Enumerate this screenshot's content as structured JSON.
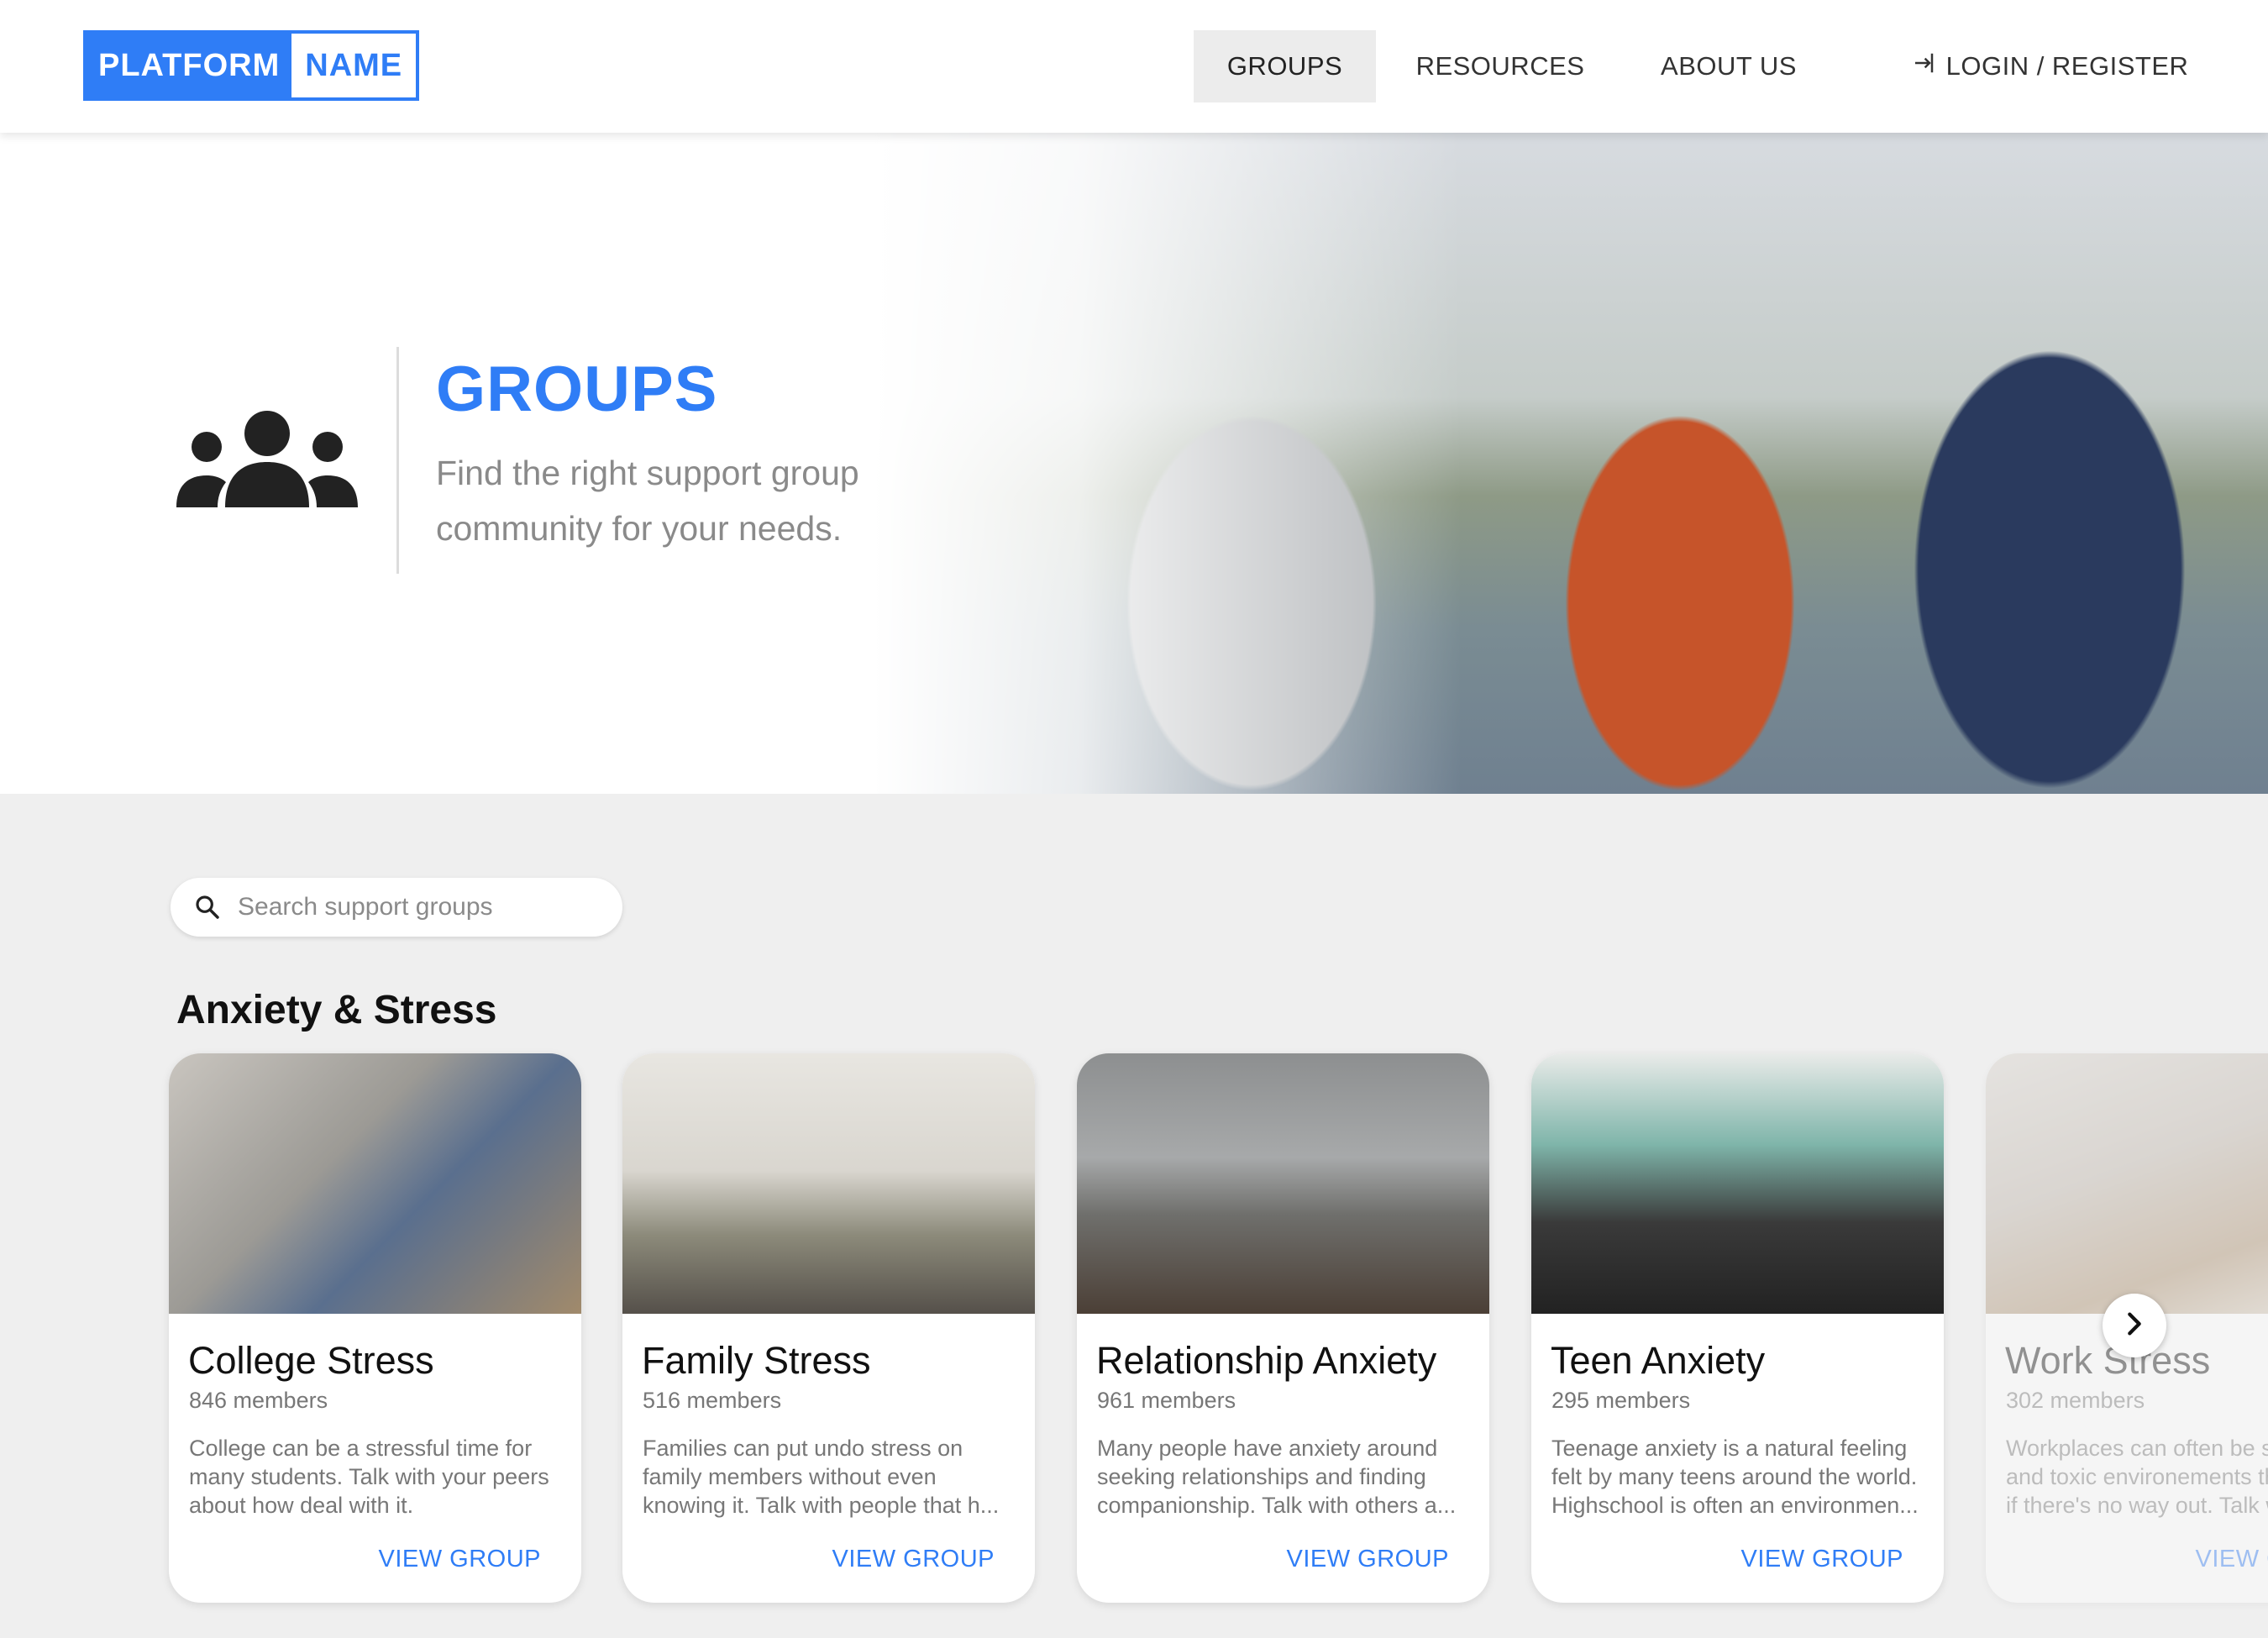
{
  "header": {
    "logo_part1": "PLATFORM",
    "logo_part2": "NAME",
    "nav": {
      "groups": "GROUPS",
      "resources": "RESOURCES",
      "about": "ABOUT US",
      "login": "LOGIN / REGISTER"
    },
    "active_nav": "GROUPS"
  },
  "hero": {
    "title": "GROUPS",
    "subtitle": "Find the right support group community for your needs.",
    "icon": "people-group-icon"
  },
  "search": {
    "placeholder": "Search support groups",
    "value": ""
  },
  "section": {
    "title": "Anxiety & Stress"
  },
  "cards": [
    {
      "name": "College Stress",
      "members": "846 members",
      "description": "College can be a stressful time for many students. Talk with your peers about how deal with it.",
      "action": "VIEW GROUP"
    },
    {
      "name": "Family Stress",
      "members": "516 members",
      "description": "Families can put undo stress on family members without even knowing it. Talk with people that h...",
      "action": "VIEW GROUP"
    },
    {
      "name": "Relationship Anxiety",
      "members": "961 members",
      "description": "Many people have anxiety around seeking relationships and finding companionship. Talk with others a...",
      "action": "VIEW GROUP"
    },
    {
      "name": "Teen Anxiety",
      "members": "295 members",
      "description": "Teenage anxiety is a natural feeling felt by many teens around the world. Highschool is often an environmen...",
      "action": "VIEW GROUP"
    },
    {
      "name": "Work Stress",
      "members": "302 members",
      "description": "Workplaces can often be stressful and toxic environements that feel as if there's no way out. Talk w",
      "action": "VIEW GROUP"
    }
  ],
  "colors": {
    "accent": "#2f7df6",
    "background": "#efefef"
  },
  "icons": {
    "login": "login-icon",
    "search": "search-icon",
    "next": "chevron-right-icon"
  }
}
